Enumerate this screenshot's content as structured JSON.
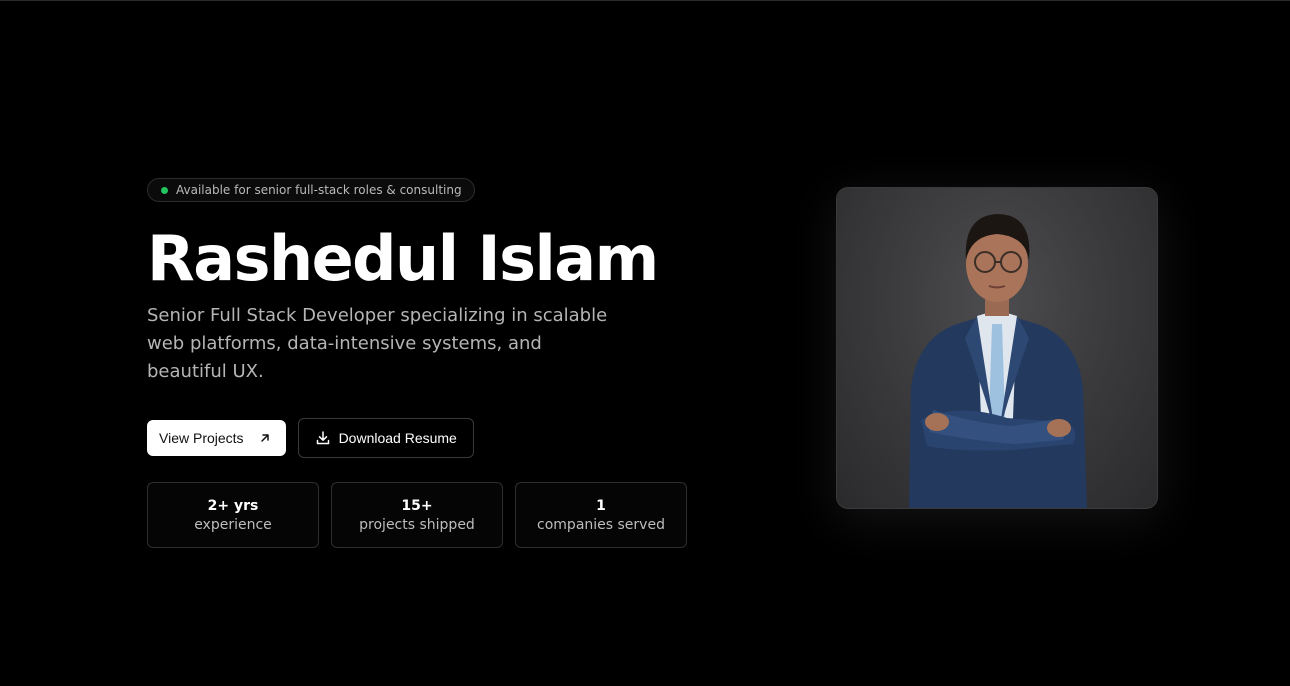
{
  "status_badge": {
    "text": "Available for senior full-stack roles & consulting",
    "dot_color": "#22c55e"
  },
  "hero": {
    "name": "Rashedul Islam",
    "subtitle": "Senior Full Stack Developer specializing in scalable web platforms, data-intensive systems, and beautiful UX."
  },
  "actions": {
    "view_projects_label": "View Projects",
    "view_projects_icon": "arrow-up-right-icon",
    "download_resume_label": "Download Resume",
    "download_resume_icon": "download-icon"
  },
  "stats": [
    {
      "value": "2+ yrs",
      "label": "experience"
    },
    {
      "value": "15+",
      "label": "projects shipped"
    },
    {
      "value": "1",
      "label": "companies served"
    }
  ],
  "profile_photo": {
    "subject": "portrait photo"
  },
  "colors": {
    "background": "#000000",
    "accent": "#22c55e",
    "primary_button_bg": "#ffffff"
  }
}
